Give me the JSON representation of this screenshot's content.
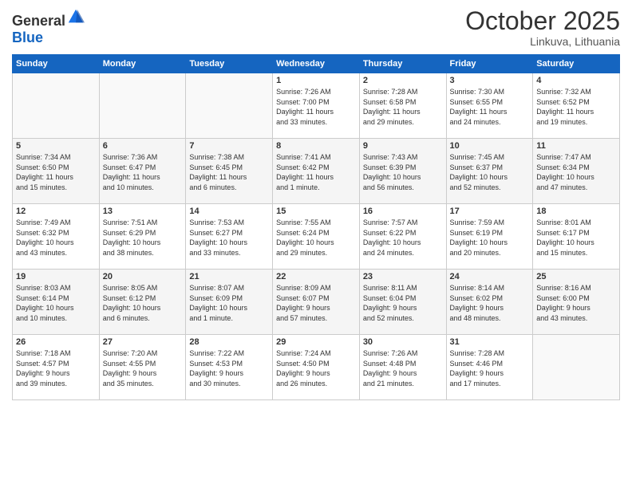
{
  "header": {
    "logo_general": "General",
    "logo_blue": "Blue",
    "month": "October 2025",
    "location": "Linkuva, Lithuania"
  },
  "days_of_week": [
    "Sunday",
    "Monday",
    "Tuesday",
    "Wednesday",
    "Thursday",
    "Friday",
    "Saturday"
  ],
  "weeks": [
    [
      {
        "day": "",
        "info": ""
      },
      {
        "day": "",
        "info": ""
      },
      {
        "day": "",
        "info": ""
      },
      {
        "day": "1",
        "info": "Sunrise: 7:26 AM\nSunset: 7:00 PM\nDaylight: 11 hours\nand 33 minutes."
      },
      {
        "day": "2",
        "info": "Sunrise: 7:28 AM\nSunset: 6:58 PM\nDaylight: 11 hours\nand 29 minutes."
      },
      {
        "day": "3",
        "info": "Sunrise: 7:30 AM\nSunset: 6:55 PM\nDaylight: 11 hours\nand 24 minutes."
      },
      {
        "day": "4",
        "info": "Sunrise: 7:32 AM\nSunset: 6:52 PM\nDaylight: 11 hours\nand 19 minutes."
      }
    ],
    [
      {
        "day": "5",
        "info": "Sunrise: 7:34 AM\nSunset: 6:50 PM\nDaylight: 11 hours\nand 15 minutes."
      },
      {
        "day": "6",
        "info": "Sunrise: 7:36 AM\nSunset: 6:47 PM\nDaylight: 11 hours\nand 10 minutes."
      },
      {
        "day": "7",
        "info": "Sunrise: 7:38 AM\nSunset: 6:45 PM\nDaylight: 11 hours\nand 6 minutes."
      },
      {
        "day": "8",
        "info": "Sunrise: 7:41 AM\nSunset: 6:42 PM\nDaylight: 11 hours\nand 1 minute."
      },
      {
        "day": "9",
        "info": "Sunrise: 7:43 AM\nSunset: 6:39 PM\nDaylight: 10 hours\nand 56 minutes."
      },
      {
        "day": "10",
        "info": "Sunrise: 7:45 AM\nSunset: 6:37 PM\nDaylight: 10 hours\nand 52 minutes."
      },
      {
        "day": "11",
        "info": "Sunrise: 7:47 AM\nSunset: 6:34 PM\nDaylight: 10 hours\nand 47 minutes."
      }
    ],
    [
      {
        "day": "12",
        "info": "Sunrise: 7:49 AM\nSunset: 6:32 PM\nDaylight: 10 hours\nand 43 minutes."
      },
      {
        "day": "13",
        "info": "Sunrise: 7:51 AM\nSunset: 6:29 PM\nDaylight: 10 hours\nand 38 minutes."
      },
      {
        "day": "14",
        "info": "Sunrise: 7:53 AM\nSunset: 6:27 PM\nDaylight: 10 hours\nand 33 minutes."
      },
      {
        "day": "15",
        "info": "Sunrise: 7:55 AM\nSunset: 6:24 PM\nDaylight: 10 hours\nand 29 minutes."
      },
      {
        "day": "16",
        "info": "Sunrise: 7:57 AM\nSunset: 6:22 PM\nDaylight: 10 hours\nand 24 minutes."
      },
      {
        "day": "17",
        "info": "Sunrise: 7:59 AM\nSunset: 6:19 PM\nDaylight: 10 hours\nand 20 minutes."
      },
      {
        "day": "18",
        "info": "Sunrise: 8:01 AM\nSunset: 6:17 PM\nDaylight: 10 hours\nand 15 minutes."
      }
    ],
    [
      {
        "day": "19",
        "info": "Sunrise: 8:03 AM\nSunset: 6:14 PM\nDaylight: 10 hours\nand 10 minutes."
      },
      {
        "day": "20",
        "info": "Sunrise: 8:05 AM\nSunset: 6:12 PM\nDaylight: 10 hours\nand 6 minutes."
      },
      {
        "day": "21",
        "info": "Sunrise: 8:07 AM\nSunset: 6:09 PM\nDaylight: 10 hours\nand 1 minute."
      },
      {
        "day": "22",
        "info": "Sunrise: 8:09 AM\nSunset: 6:07 PM\nDaylight: 9 hours\nand 57 minutes."
      },
      {
        "day": "23",
        "info": "Sunrise: 8:11 AM\nSunset: 6:04 PM\nDaylight: 9 hours\nand 52 minutes."
      },
      {
        "day": "24",
        "info": "Sunrise: 8:14 AM\nSunset: 6:02 PM\nDaylight: 9 hours\nand 48 minutes."
      },
      {
        "day": "25",
        "info": "Sunrise: 8:16 AM\nSunset: 6:00 PM\nDaylight: 9 hours\nand 43 minutes."
      }
    ],
    [
      {
        "day": "26",
        "info": "Sunrise: 7:18 AM\nSunset: 4:57 PM\nDaylight: 9 hours\nand 39 minutes."
      },
      {
        "day": "27",
        "info": "Sunrise: 7:20 AM\nSunset: 4:55 PM\nDaylight: 9 hours\nand 35 minutes."
      },
      {
        "day": "28",
        "info": "Sunrise: 7:22 AM\nSunset: 4:53 PM\nDaylight: 9 hours\nand 30 minutes."
      },
      {
        "day": "29",
        "info": "Sunrise: 7:24 AM\nSunset: 4:50 PM\nDaylight: 9 hours\nand 26 minutes."
      },
      {
        "day": "30",
        "info": "Sunrise: 7:26 AM\nSunset: 4:48 PM\nDaylight: 9 hours\nand 21 minutes."
      },
      {
        "day": "31",
        "info": "Sunrise: 7:28 AM\nSunset: 4:46 PM\nDaylight: 9 hours\nand 17 minutes."
      },
      {
        "day": "",
        "info": ""
      }
    ]
  ]
}
